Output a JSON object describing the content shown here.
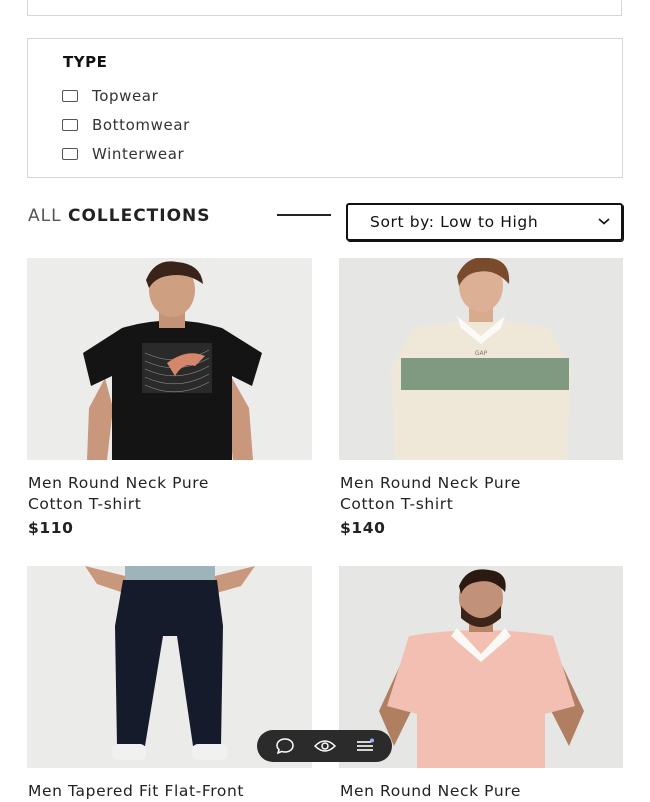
{
  "filter": {
    "title": "TYPE",
    "options": [
      {
        "label": "Topwear",
        "checked": false
      },
      {
        "label": "Bottomwear",
        "checked": false
      },
      {
        "label": "Winterwear",
        "checked": false
      }
    ]
  },
  "collections": {
    "heading_light": "ALL",
    "heading_bold": "COLLECTIONS",
    "sort_label": "Sort by: Low to High"
  },
  "products": [
    {
      "name_line1": "Men Round Neck Pure",
      "name_line2": "Cotton T-shirt",
      "price": "$110"
    },
    {
      "name_line1": "Men Round Neck Pure",
      "name_line2": "Cotton T-shirt",
      "price": "$140"
    },
    {
      "name_line1": "Men Tapered Fit Flat-Front",
      "name_line2": "",
      "price": ""
    },
    {
      "name_line1": "Men Round Neck Pure",
      "name_line2": "",
      "price": ""
    }
  ],
  "float_bar": {
    "icons": [
      "chat-icon",
      "eye-icon",
      "menu-icon"
    ]
  },
  "colors": {
    "border": "#d6d6d6",
    "text": "#222222",
    "float_bar_bg": "#2b2b2b"
  }
}
